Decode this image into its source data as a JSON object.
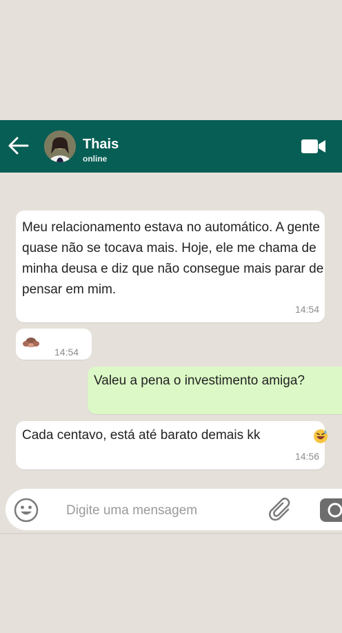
{
  "header": {
    "contact_name": "Thais",
    "status": "online",
    "background": "#075e54"
  },
  "messages": [
    {
      "direction": "in",
      "text": "Meu relacionamento estava no automático. A gente quase não se tocava mais. Hoje, ele me chama de minha deusa e diz que não consegue mais parar de pensar em mim.",
      "time": "14:54"
    },
    {
      "direction": "in",
      "emoji": "see-no-evil-monkey",
      "time": "14:54"
    },
    {
      "direction": "out",
      "text": "Valeu a pena o investimento amiga?"
    },
    {
      "direction": "in",
      "text": "Cada centavo, está até barato demais kk",
      "emoji": "grinning-sweat-face",
      "time": "14:56"
    }
  ],
  "composer": {
    "placeholder": "Digite uma mensagem",
    "icons": [
      "smiley-icon",
      "paperclip-icon",
      "camera-icon"
    ]
  },
  "colors": {
    "chat_background": "#e5e1da",
    "incoming_bubble": "#ffffff",
    "outgoing_bubble": "#dcf8c6"
  }
}
